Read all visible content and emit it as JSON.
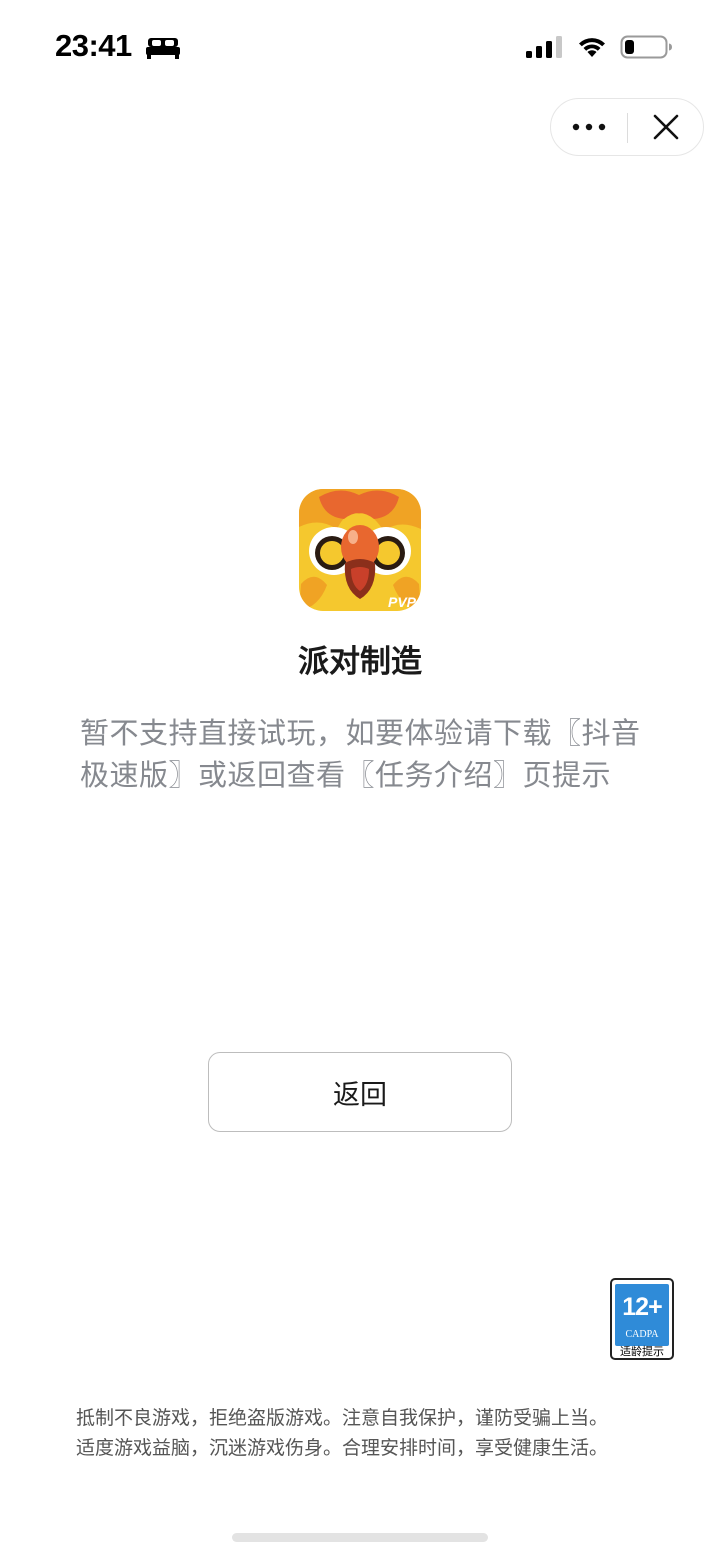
{
  "status_bar": {
    "time": "23:41",
    "sleep_icon": "bed-icon",
    "signal_icon": "cellular-signal-icon",
    "wifi_icon": "wifi-icon",
    "battery_icon": "battery-icon",
    "battery_level": 0.2
  },
  "capsule": {
    "more_icon": "more-dots-icon",
    "close_icon": "close-icon"
  },
  "app": {
    "icon": "game-app-icon",
    "icon_badge": "PVP",
    "name": "派对制造",
    "message": "暂不支持直接试玩，如要体验请下载〖抖音极速版〗或返回查看〖任务介绍〗页提示"
  },
  "back_button": {
    "label": "返回"
  },
  "age_rating": {
    "age": "12+",
    "org": "CADPA",
    "tip": "适龄提示"
  },
  "notice": {
    "line1": "抵制不良游戏，拒绝盗版游戏。注意自我保护，谨防受骗上当。",
    "line2": "适度游戏益脑，沉迷游戏伤身。合理安排时间，享受健康生活。"
  },
  "colors": {
    "accent_blue": "#2f8bd8",
    "message_gray": "#86898f",
    "icon_yellow": "#f5c82e",
    "icon_orange": "#e8672f"
  }
}
